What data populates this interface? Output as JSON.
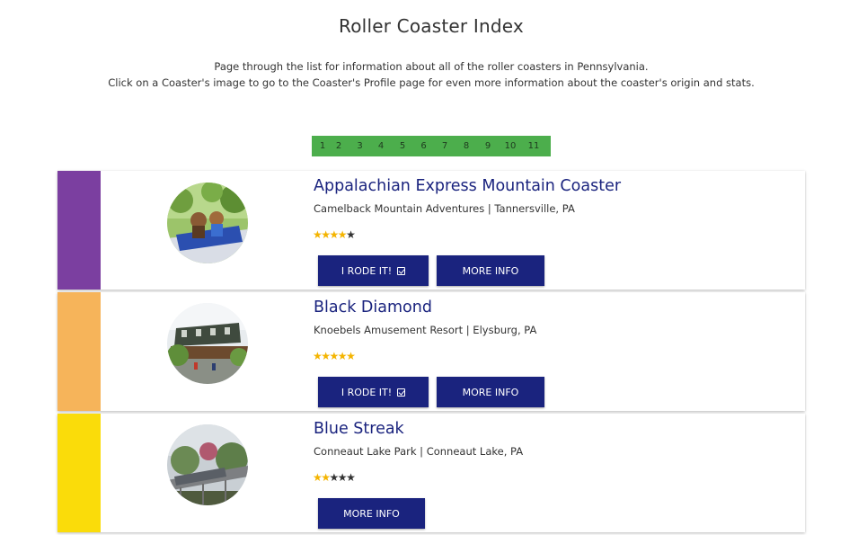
{
  "page": {
    "title": "Roller Coaster Index",
    "intro_line1": "Page through the list for information about all of the roller coasters in Pennsylvania.",
    "intro_line2": "Click on a Coaster's image to go to the Coaster's Profile page for even more information about the coaster's origin and stats."
  },
  "pagination": {
    "pages": [
      "1",
      "2",
      "3",
      "4",
      "5",
      "6",
      "7",
      "8",
      "9",
      "10",
      "11"
    ],
    "color": "#4cae4c"
  },
  "buttons": {
    "rode_label": "I RODE IT!",
    "more_label": "MORE INFO"
  },
  "coasters": [
    {
      "name": "Appalachian Express Mountain Coaster",
      "location": "Camelback Mountain Adventures | Tannersville, PA",
      "rating": 4,
      "stripe_color": "#7b3fa0",
      "show_rode": true
    },
    {
      "name": "Black Diamond",
      "location": "Knoebels Amusement Resort | Elysburg, PA",
      "rating": 5,
      "stripe_color": "#f6b45a",
      "show_rode": true
    },
    {
      "name": "Blue Streak",
      "location": "Conneaut Lake Park | Conneaut Lake, PA",
      "rating": 2,
      "stripe_color": "#fadc0a",
      "show_rode": false
    }
  ]
}
